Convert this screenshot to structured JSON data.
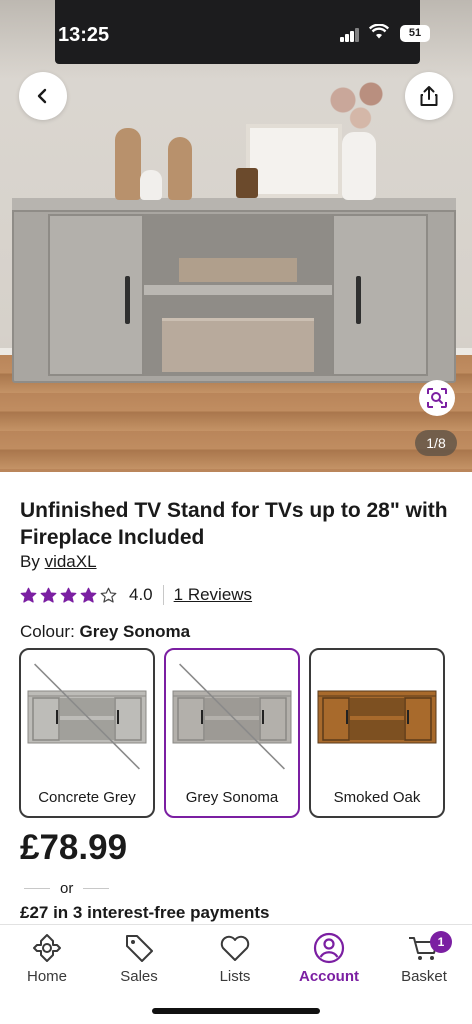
{
  "status_bar": {
    "time": "13:25",
    "battery": "51"
  },
  "gallery": {
    "counter": "1/8"
  },
  "product": {
    "title": "Unfinished TV Stand for TVs up to 28\" with Fireplace Included",
    "by_prefix": "By",
    "brand": "vidaXL",
    "rating": {
      "stars": 4,
      "max": 5,
      "value": "4.0",
      "reviews_label": "1 Reviews"
    },
    "colour_label": "Colour:",
    "colour_selected": "Grey Sonoma",
    "colours": [
      {
        "label": "Concrete Grey",
        "available": false,
        "selected": false,
        "color": "#bdbcb8"
      },
      {
        "label": "Grey Sonoma",
        "available": false,
        "selected": true,
        "color": "#b3b0ab"
      },
      {
        "label": "Smoked Oak",
        "available": true,
        "selected": false,
        "color": "#a86a2c"
      }
    ],
    "price": "£78.99",
    "or_label": "or",
    "installments": "£27 in 3 interest-free payments"
  },
  "bottom_nav": {
    "items": [
      {
        "label": "Home",
        "icon": "home-icon",
        "active": false
      },
      {
        "label": "Sales",
        "icon": "tag-icon",
        "active": false
      },
      {
        "label": "Lists",
        "icon": "heart-icon",
        "active": false
      },
      {
        "label": "Account",
        "icon": "account-icon",
        "active": true
      },
      {
        "label": "Basket",
        "icon": "basket-icon",
        "active": false,
        "badge": "1"
      }
    ]
  },
  "colors": {
    "accent": "#7b1fa2",
    "text": "#1a1a1a"
  }
}
